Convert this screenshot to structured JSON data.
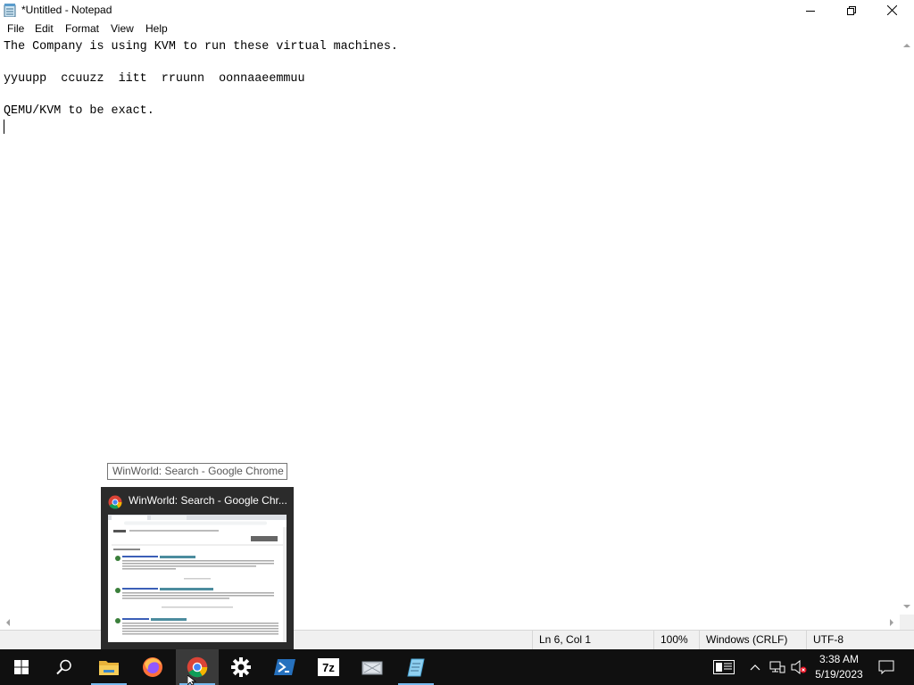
{
  "window": {
    "title": "*Untitled - Notepad",
    "icon": "notepad-icon",
    "controls": {
      "minimize": "minimize-icon",
      "restore": "restore-icon",
      "close": "close-icon"
    }
  },
  "menu": {
    "items": [
      {
        "label": "File"
      },
      {
        "label": "Edit"
      },
      {
        "label": "Format"
      },
      {
        "label": "View"
      },
      {
        "label": "Help"
      }
    ]
  },
  "editor": {
    "lines": [
      "The Company is using KVM to run these virtual machines.",
      "",
      "yyuupp  ccuuzz  iitt  rruunn  oonnaaeemmuu",
      "",
      "QEMU/KVM to be exact.",
      ""
    ]
  },
  "status": {
    "position": "Ln 6, Col 1",
    "zoom": "100%",
    "line_ending": "Windows (CRLF)",
    "encoding": "UTF-8"
  },
  "tooltip": {
    "text": "WinWorld: Search - Google Chrome"
  },
  "thumbnail": {
    "title": "WinWorld: Search - Google Chr...",
    "icon": "chrome-icon"
  },
  "taskbar": {
    "apps": [
      {
        "name": "start-icon"
      },
      {
        "name": "search-icon"
      },
      {
        "name": "file-explorer-icon"
      },
      {
        "name": "firefox-icon"
      },
      {
        "name": "chrome-icon"
      },
      {
        "name": "settings-gear-icon"
      },
      {
        "name": "powershell-icon"
      },
      {
        "name": "7zip-icon"
      },
      {
        "name": "network-diagram-icon"
      },
      {
        "name": "notepad-icon"
      }
    ],
    "tray": {
      "time": "3:38 AM",
      "date": "5/19/2023"
    }
  },
  "colors": {
    "taskbar_bg": "#101010",
    "running_indicator": "#76b9ed",
    "status_bg": "#f0f0f0"
  }
}
